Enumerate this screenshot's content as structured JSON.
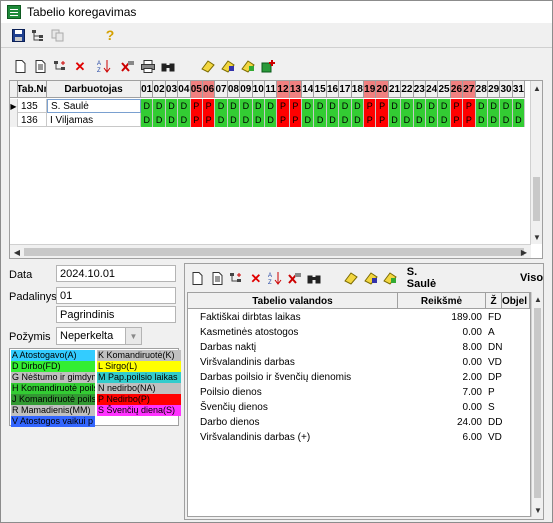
{
  "window": {
    "title": "Tabelio koregavimas"
  },
  "top_toolbar": {
    "icons": [
      "save-icon",
      "tree-icon",
      "copy-disabled-icon",
      "help-icon"
    ]
  },
  "grid_toolbar": {
    "icons": [
      "new-doc-icon",
      "doc-icon",
      "tree-add-icon",
      "delete-icon",
      "sort-icon",
      "delete-all-icon",
      "print-icon",
      "find-icon",
      "tool1-icon",
      "tool2-icon",
      "tool3-icon",
      "tool4-icon"
    ]
  },
  "grid": {
    "col_tab": "Tab.Nr",
    "col_employee": "Darbuotojas",
    "days": [
      "01",
      "02",
      "03",
      "04",
      "05",
      "06",
      "07",
      "08",
      "09",
      "10",
      "11",
      "12",
      "13",
      "14",
      "15",
      "16",
      "17",
      "18",
      "19",
      "20",
      "21",
      "22",
      "23",
      "24",
      "25",
      "26",
      "27",
      "28",
      "29",
      "30",
      "31"
    ],
    "weekend_days": [
      "05",
      "06",
      "12",
      "13",
      "19",
      "20",
      "26",
      "27"
    ],
    "rows": [
      {
        "tab": "135",
        "name": "S. Saulė",
        "selected": true,
        "codes": [
          "D",
          "D",
          "D",
          "D",
          "P",
          "P",
          "D",
          "D",
          "D",
          "D",
          "D",
          "P",
          "P",
          "D",
          "D",
          "D",
          "D",
          "D",
          "P",
          "P",
          "D",
          "D",
          "D",
          "D",
          "D",
          "P",
          "P",
          "D",
          "D",
          "D",
          "D"
        ]
      },
      {
        "tab": "136",
        "name": "I Viljamas",
        "selected": false,
        "codes": [
          "D",
          "D",
          "D",
          "D",
          "P",
          "P",
          "D",
          "D",
          "D",
          "D",
          "D",
          "P",
          "P",
          "D",
          "D",
          "D",
          "D",
          "D",
          "P",
          "P",
          "D",
          "D",
          "D",
          "D",
          "D",
          "P",
          "P",
          "D",
          "D",
          "D",
          "D"
        ]
      }
    ],
    "row_indicator": "▶"
  },
  "form": {
    "data_label": "Data",
    "data_value": "2024.10.01",
    "padalinys_label": "Padalinys",
    "padalinys_code": "01",
    "padalinys_name": "Pagrindinis",
    "pozymis_label": "Požymis",
    "pozymis_value": "Neperkelta"
  },
  "legend": [
    {
      "text": "A Atostogavo(A)",
      "color": "#33ccff"
    },
    {
      "text": "K Komandiruotė(K)",
      "color": "#c0c0c0"
    },
    {
      "text": "D Dirbo(FD)",
      "color": "#33ee33"
    },
    {
      "text": "L Sirgo(L)",
      "color": "#ffff00"
    },
    {
      "text": "G Nėštumo ir gimdym",
      "color": "#c0c0c0"
    },
    {
      "text": "M Pap.poilsio laikas",
      "color": "#33cccc"
    },
    {
      "text": "H Komandiruotė poils",
      "color": "#33cc33"
    },
    {
      "text": "N nedirbo(NA)",
      "color": "#c0c0c0"
    },
    {
      "text": "J Komandiruotė poils",
      "color": "#339933"
    },
    {
      "text": "P Nedirbo(P)",
      "color": "#ff0000"
    },
    {
      "text": "R Mamadienis(MM)",
      "color": "#c0c0c0"
    },
    {
      "text": "S Švenčių diena(S)",
      "color": "#ff33ff"
    },
    {
      "text": "V Atostogos vaikui p",
      "color": "#3366ff"
    }
  ],
  "right_panel": {
    "icons": [
      "new-doc-icon",
      "doc-icon",
      "tree-add-icon",
      "delete-icon",
      "sort-icon",
      "delete-all-icon",
      "find-icon",
      "tool1-icon",
      "tool2-icon",
      "tool3-icon"
    ],
    "employee": "S. Saulė",
    "viso_label": "Viso",
    "headers": {
      "name": "Tabelio valandos",
      "value": "Reikšmė",
      "code": "Ž",
      "obj": "Objel"
    },
    "rows": [
      {
        "name": "Faktiškai dirbtas laikas",
        "value": "189.00",
        "code": "FD"
      },
      {
        "name": "Kasmetinės atostogos",
        "value": "0.00",
        "code": "A"
      },
      {
        "name": "Darbas naktį",
        "value": "8.00",
        "code": "DN"
      },
      {
        "name": "Viršvalandinis darbas",
        "value": "0.00",
        "code": "VD"
      },
      {
        "name": "Darbas poilsio ir švenčių dienomis",
        "value": "2.00",
        "code": "DP"
      },
      {
        "name": "Poilsio dienos",
        "value": "7.00",
        "code": "P"
      },
      {
        "name": "Švenčių dienos",
        "value": "0.00",
        "code": "S"
      },
      {
        "name": "Darbo dienos",
        "value": "24.00",
        "code": "DD"
      },
      {
        "name": "Viršvalandinis darbas (+)",
        "value": "6.00",
        "code": "VD"
      }
    ]
  },
  "colors": {
    "work_day": "#33cc33",
    "rest_day": "#ff0000",
    "weekend_header": "#f08080"
  }
}
